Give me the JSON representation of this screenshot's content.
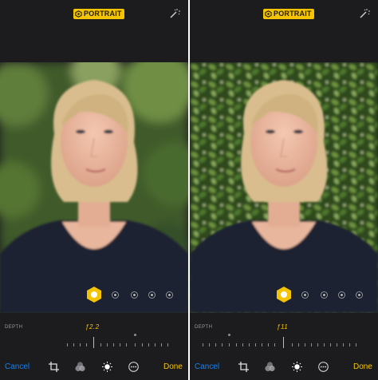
{
  "panels": [
    {
      "badge": "PORTRAIT",
      "depth_label": "DEPTH",
      "fstop": "ƒ2.2",
      "cancel": "Cancel",
      "done": "Done",
      "background_blur": "heavy"
    },
    {
      "badge": "PORTRAIT",
      "depth_label": "DEPTH",
      "fstop": "ƒ11",
      "cancel": "Cancel",
      "done": "Done",
      "background_blur": "light"
    }
  ],
  "icons": {
    "badge": "portrait-cube-icon",
    "top_right": "magic-wand-icon",
    "lighting_selected": "natural-light-icon",
    "toolbar": [
      "crop-icon",
      "filters-icon",
      "adjust-icon",
      "more-icon"
    ]
  },
  "colors": {
    "accent": "#f5c400",
    "cancel": "#0a84ff",
    "chrome": "#1c1c1e"
  }
}
